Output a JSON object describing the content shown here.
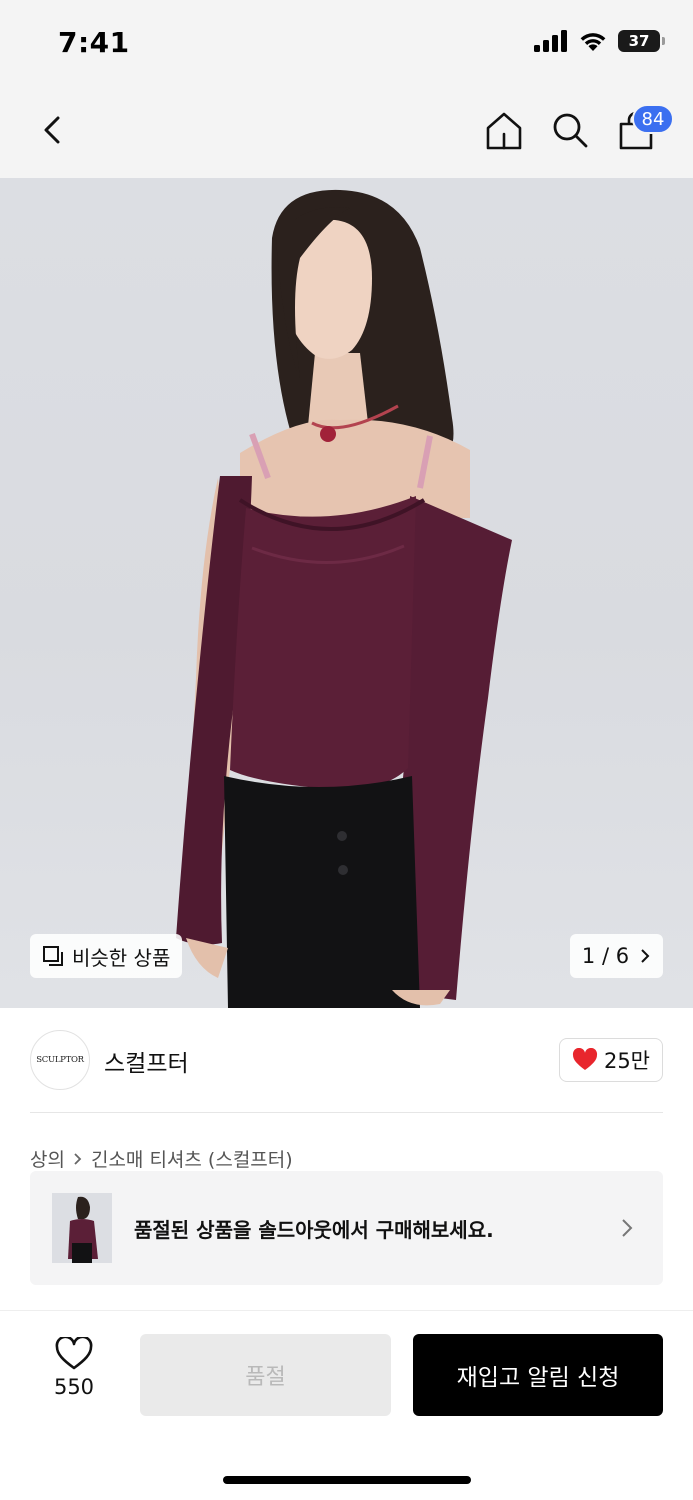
{
  "status_bar": {
    "time": "7:41",
    "battery_level": "37",
    "battery_fraction": 0.37
  },
  "nav": {
    "cart_count": "84"
  },
  "gallery": {
    "similar_label": "비슷한 상품",
    "pager": "1 / 6"
  },
  "brand": {
    "logo_text": "SCULPTOR",
    "name": "스컬프터",
    "likes": "25만"
  },
  "breadcrumb": {
    "items": [
      "상의",
      "긴소매 티셔츠 (스컬프터)"
    ]
  },
  "soldout_banner": {
    "message": "품절된 상품을 솔드아웃에서 구매해보세요."
  },
  "bottom_bar": {
    "wish_count": "550",
    "soldout_label": "품절",
    "restock_label": "재입고 알림 신청"
  },
  "colors": {
    "accent_blue": "#3b6ff0",
    "heart_red": "#e8262d",
    "top_burgundy": "#5b1f37"
  }
}
